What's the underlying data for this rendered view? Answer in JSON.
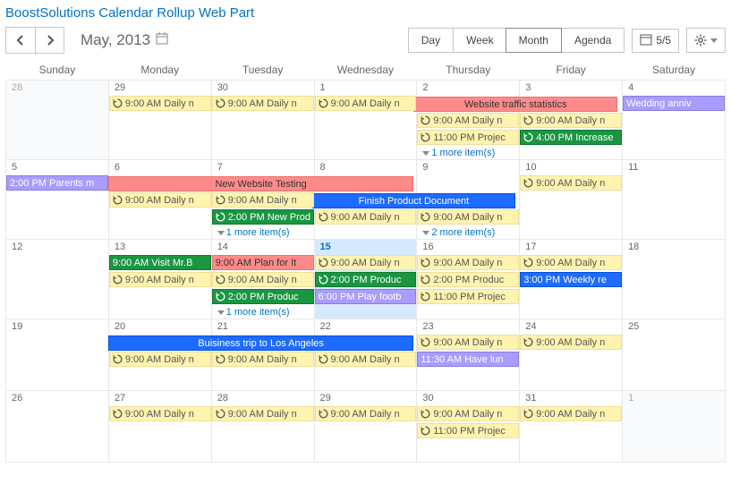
{
  "title": "BoostSolutions Calendar Rollup Web Part",
  "month_label": "May, 2013",
  "view_buttons": {
    "day": "Day",
    "week": "Week",
    "month": "Month",
    "agenda": "Agenda"
  },
  "cal_count": "5/5",
  "weekdays": [
    "Sunday",
    "Monday",
    "Tuesday",
    "Wednesday",
    "Thursday",
    "Friday",
    "Saturday"
  ],
  "daynums": [
    [
      "28",
      "29",
      "30",
      "1",
      "2",
      "3",
      "4"
    ],
    [
      "5",
      "6",
      "7",
      "8",
      "9",
      "10",
      "11"
    ],
    [
      "12",
      "13",
      "14",
      "15",
      "16",
      "17",
      "18"
    ],
    [
      "19",
      "20",
      "21",
      "22",
      "23",
      "24",
      "25"
    ],
    [
      "26",
      "27",
      "28",
      "29",
      "30",
      "31",
      "1"
    ]
  ],
  "outside": {
    "r0c0": true,
    "r4c6": true
  },
  "today": "r2c3",
  "events": {
    "daily_9am": "9:00 AM Daily n",
    "proj_11pm": "11:00 PM Projec",
    "website_traffic": "Website traffic statistics",
    "increase_4pm": "4:00 PM Increase",
    "wedding": "Wedding anniv",
    "parents_2pm": "2:00 PM Parents m",
    "new_website_testing": "New Website Testing",
    "finish_product_doc": "Finish Product Document",
    "new_prod_2pm": "2:00 PM New Prod",
    "visit_mrb": "9:00 AM Visit Mr.B",
    "plan_it": "9:00 AM Plan for It",
    "prod_2pm_g": "2:00 PM Produc",
    "prod_2pm_b": "2:00 PM Produc",
    "football_6pm": "6:00 PM Play footb",
    "weekly_3pm": "3:00 PM Weekly re",
    "biz_trip": "Buisiness trip to Los Angeles",
    "have_lun": "11:30 AM Have lun"
  },
  "more": {
    "one": "1 more item(s)",
    "two": "2 more item(s)"
  }
}
